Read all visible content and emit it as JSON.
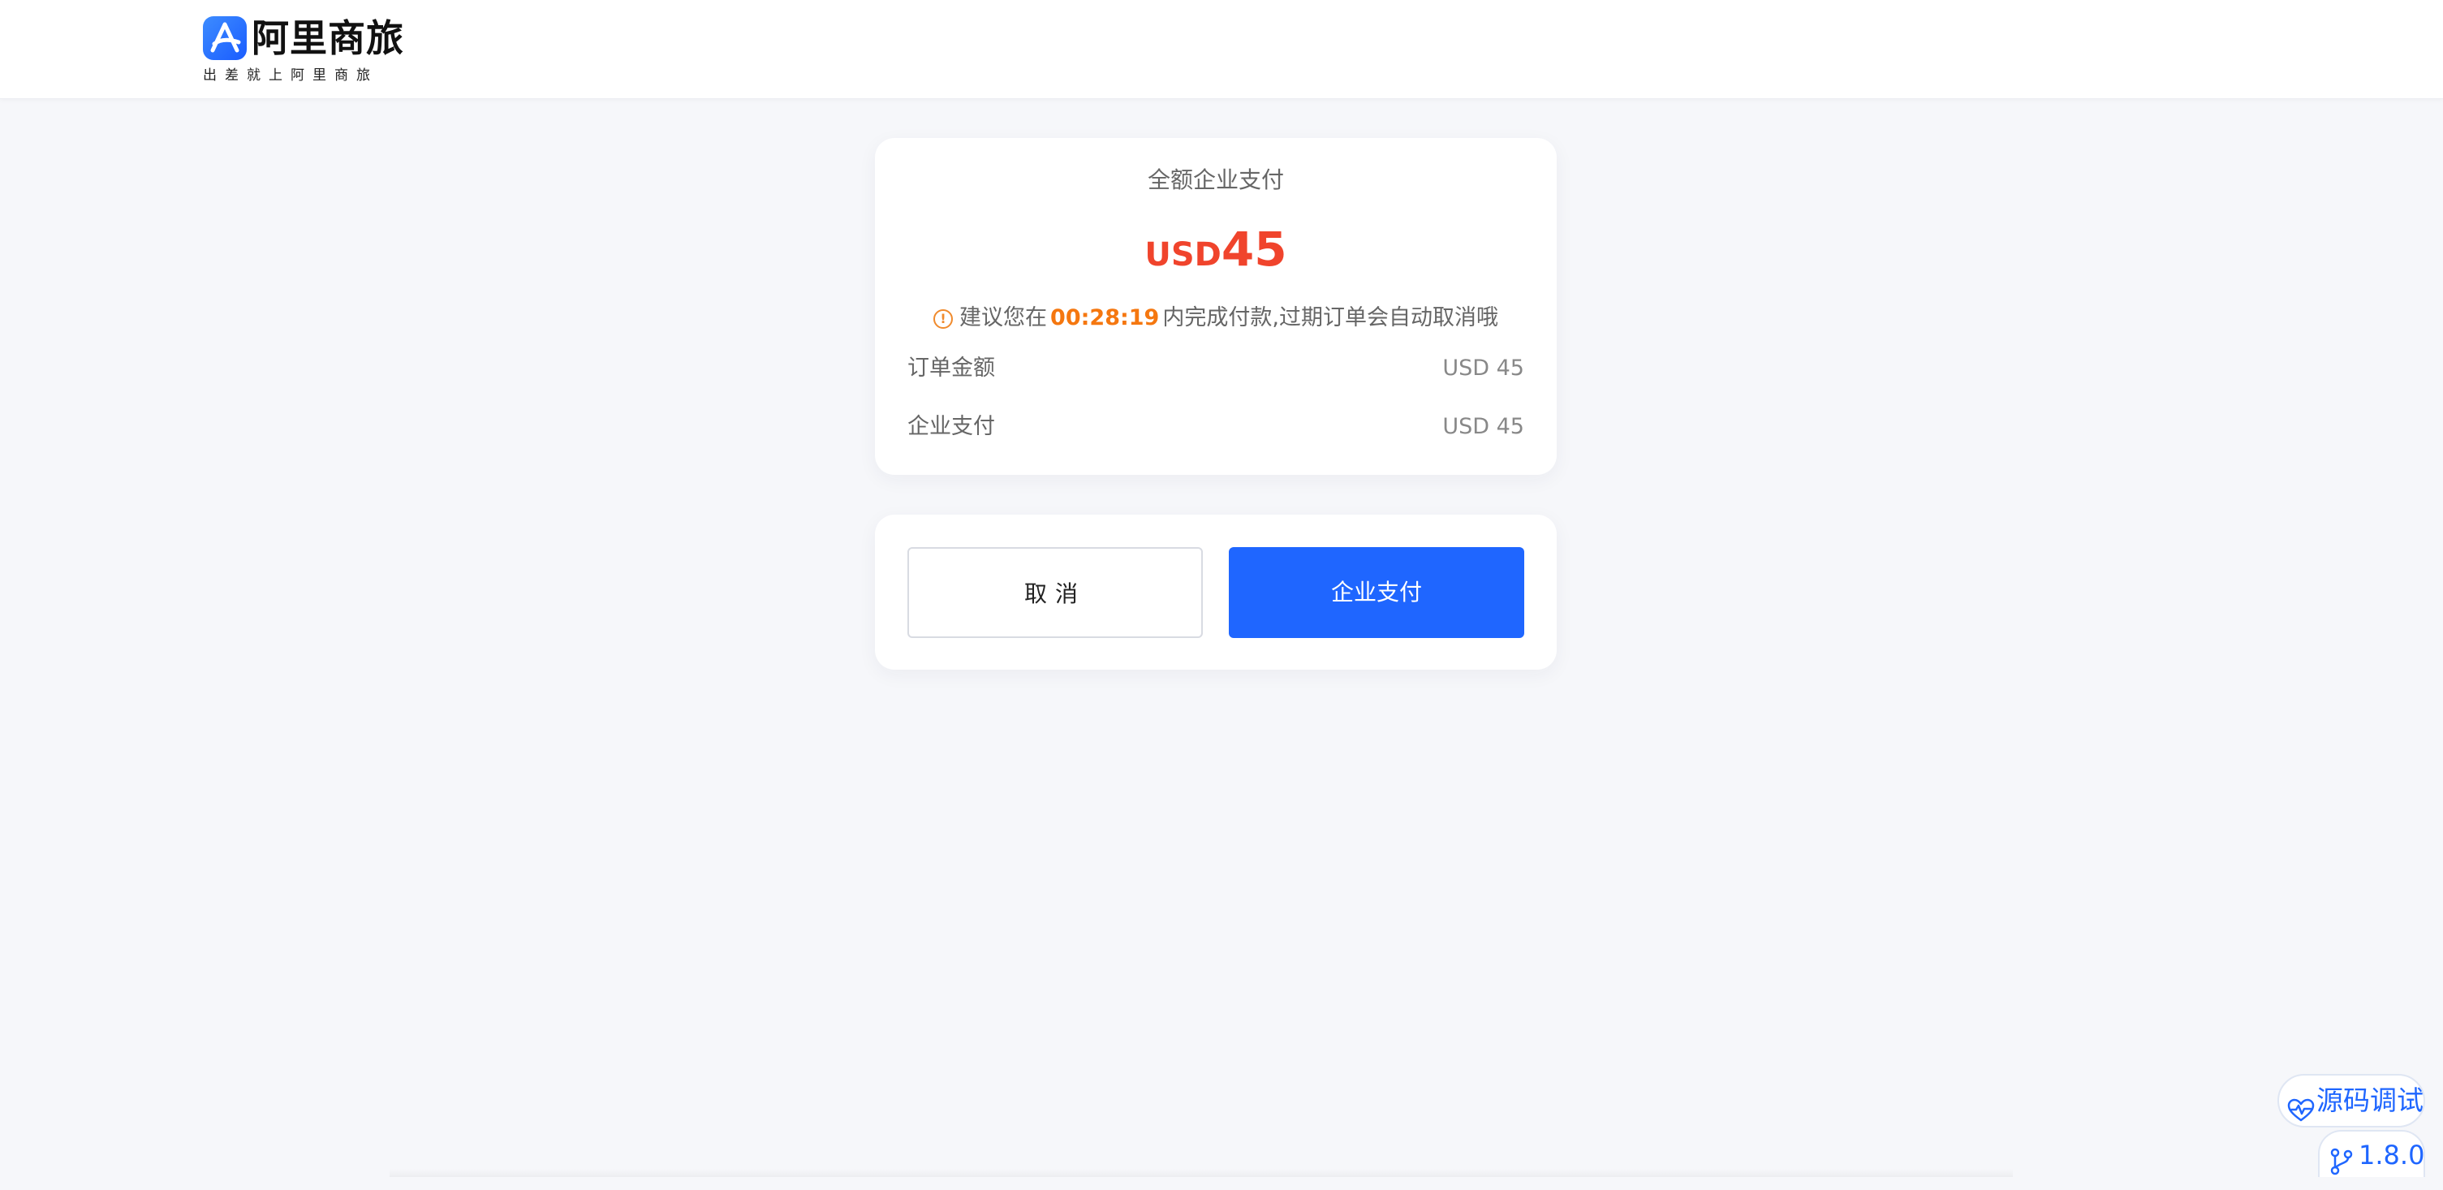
{
  "header": {
    "brand_name": "阿里商旅",
    "slogan": "出差就上阿里商旅"
  },
  "summary": {
    "pay_type": "全额企业支付",
    "amount_currency": "USD",
    "amount_value": "45",
    "tip_prefix": "建议您在",
    "tip_time": "00:28:19",
    "tip_suffix": "内完成付款,过期订单会自动取消哦",
    "rows": [
      {
        "label": "订单金额",
        "value": "USD 45"
      },
      {
        "label": "企业支付",
        "value": "USD 45"
      }
    ]
  },
  "actions": {
    "cancel_label": "取消",
    "pay_label": "企业支付"
  },
  "floating": {
    "debug_label": "源码调试",
    "version_label": "1.8.0"
  },
  "colors": {
    "primary": "#1f66ff",
    "amount": "#f0442c",
    "countdown": "#f5770f"
  },
  "icons": {
    "logo": "alitrip-logo-icon",
    "tip": "info-circle-icon",
    "debug": "heart-pulse-icon",
    "version": "git-branch-icon"
  }
}
